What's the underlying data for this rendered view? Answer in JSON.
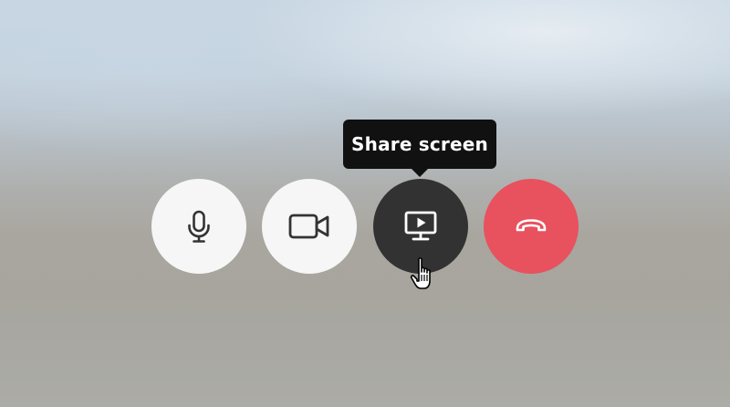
{
  "tooltip": {
    "text": "Share screen"
  },
  "controls": [
    {
      "name": "microphone",
      "icon": "microphone-icon",
      "background": "#f6f6f6",
      "icon_color": "#333333"
    },
    {
      "name": "camera",
      "icon": "video-camera-icon",
      "background": "#f6f6f6",
      "icon_color": "#333333"
    },
    {
      "name": "share-screen",
      "icon": "screen-share-icon",
      "background": "#323232",
      "icon_color": "#ffffff",
      "hovered": true
    },
    {
      "name": "hang-up",
      "icon": "phone-hangup-icon",
      "background": "#e8515e",
      "icon_color": "#ffffff"
    }
  ],
  "cursor": {
    "icon": "hand-pointer-icon"
  }
}
